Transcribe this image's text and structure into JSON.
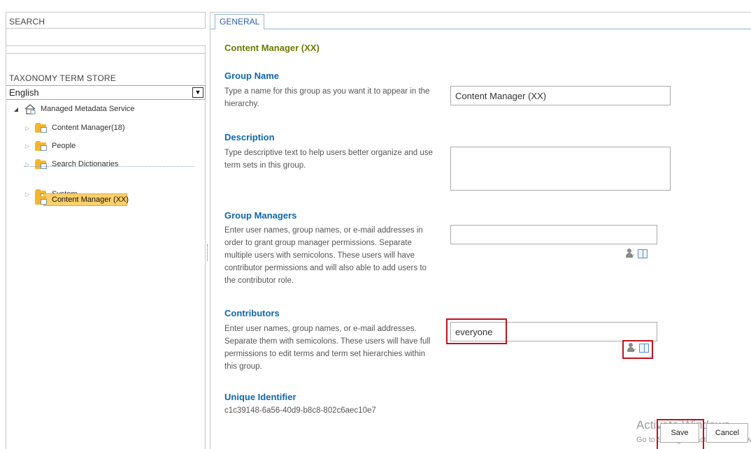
{
  "left": {
    "search_heading": "SEARCH",
    "search_value": "",
    "store_heading": "TAXONOMY TERM STORE",
    "language": "English",
    "tree": {
      "root": "Managed Metadata Service",
      "items": [
        "Content Manager(18)",
        "People",
        "Search Dictionaries"
      ],
      "system": "System",
      "selected": "Content Manager (XX)"
    }
  },
  "tab": {
    "label": "GENERAL"
  },
  "form": {
    "title": "Content Manager (XX)",
    "group_name": {
      "title": "Group Name",
      "desc": "Type a name for this group as you want it to appear in the hierarchy.",
      "value": "Content Manager (XX)"
    },
    "description": {
      "title": "Description",
      "desc": "Type descriptive text to help users better organize and use term sets in this group.",
      "value": ""
    },
    "group_managers": {
      "title": "Group Managers",
      "desc": "Enter user names, group names, or e-mail addresses in order to grant group manager permissions. Separate multiple users with semicolons. These users will have contributor permissions and will also able to add users to the contributor role.",
      "value": ""
    },
    "contributors": {
      "title": "Contributors",
      "desc": "Enter user names, group names, or e-mail addresses. Separate them with semicolons. These users will have full permissions to edit terms and term set hierarchies within this group.",
      "value": "everyone"
    },
    "unique_identifier": {
      "title": "Unique Identifier",
      "value": "c1c39148-6a56-40d9-b8c8-802c6aec10e7"
    }
  },
  "buttons": {
    "save": "Save",
    "cancel": "Cancel"
  },
  "watermark": {
    "line1": "Activate Windows",
    "line2": "Go to Settings to activate Windows."
  },
  "colors": {
    "accent_title": "#0f67b1",
    "page_title": "#6c7a00",
    "highlight": "#c1121f",
    "selected": "#fbcf6b"
  }
}
